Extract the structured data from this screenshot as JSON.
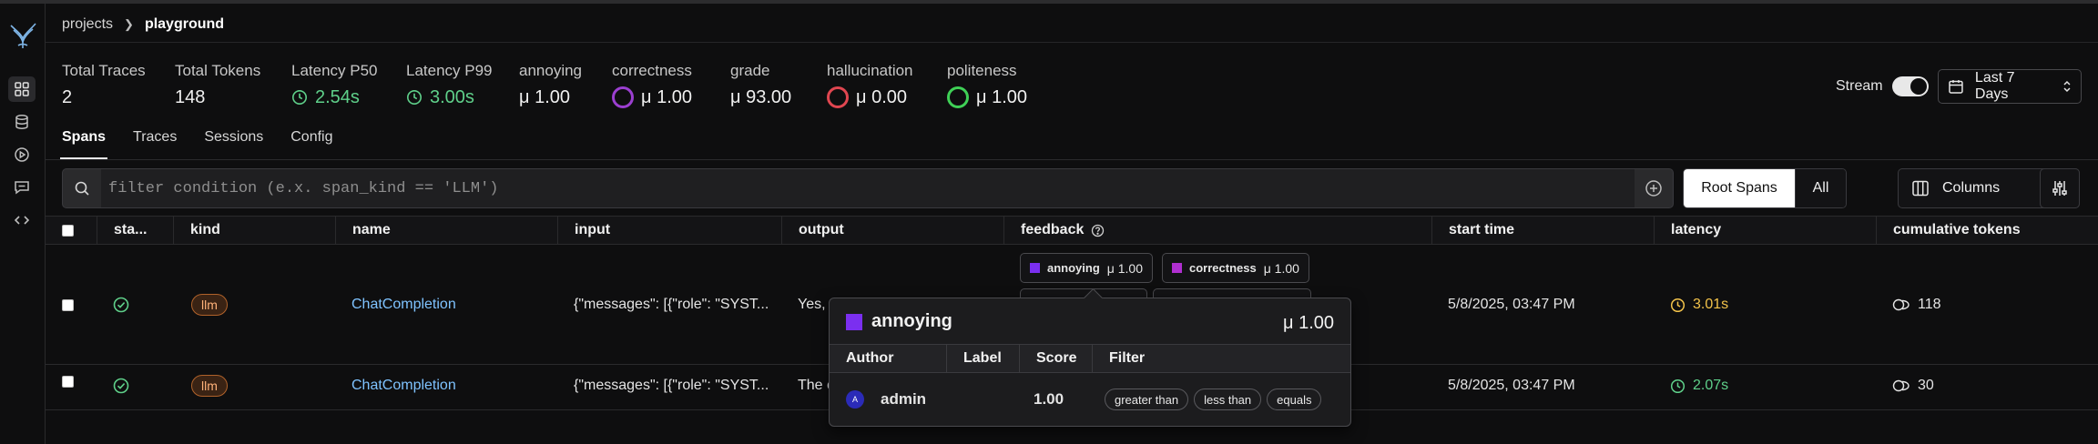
{
  "breadcrumb": {
    "items": [
      "projects"
    ],
    "current": "playground"
  },
  "stats": [
    {
      "label": "Total Traces",
      "value": "2"
    },
    {
      "label": "Total Tokens",
      "value": "148"
    },
    {
      "label": "Latency P50",
      "value": "2.54s",
      "icon": "clock-icon",
      "color": "#5fd08a"
    },
    {
      "label": "Latency P99",
      "value": "3.00s",
      "icon": "clock-icon",
      "color": "#5fd08a"
    },
    {
      "label": "annoying",
      "value": "μ 1.00"
    },
    {
      "label": "correctness",
      "value": "μ 1.00",
      "ring_color": "#9b3fd0"
    },
    {
      "label": "grade",
      "value": "μ 93.00"
    },
    {
      "label": "hallucination",
      "value": "μ 0.00",
      "ring_color": "#e04650"
    },
    {
      "label": "politeness",
      "value": "μ 1.00",
      "ring_color": "#3fd056"
    }
  ],
  "stream": {
    "label": "Stream",
    "enabled": true
  },
  "timerange": {
    "label": "Last 7 Days"
  },
  "tabs": [
    "Spans",
    "Traces",
    "Sessions",
    "Config"
  ],
  "active_tab": "Spans",
  "filter": {
    "placeholder": "filter condition (e.x. span_kind == 'LLM')",
    "value": ""
  },
  "span_toggle": {
    "root_label": "Root Spans",
    "all_label": "All",
    "selected": "Root Spans"
  },
  "columns_button": {
    "label": "Columns"
  },
  "table": {
    "headers": {
      "status": "sta...",
      "kind": "kind",
      "name": "name",
      "input": "input",
      "output": "output",
      "feedback": "feedback",
      "start_time": "start time",
      "latency": "latency",
      "cumulative_tokens": "cumulative tokens"
    },
    "rows": [
      {
        "kind": "llm",
        "name": "ChatCompletion",
        "input": "{\"messages\": [{\"role\": \"SYST...",
        "output": "Yes, c",
        "feedback": [
          {
            "name": "annoying",
            "score": "μ 1.00",
            "color": "#7b2ff0"
          },
          {
            "name": "correctness",
            "score": "μ 1.00",
            "color": "#b02fd0"
          }
        ],
        "start_time": "5/8/2025, 03:47 PM",
        "latency": "3.01s",
        "latency_color": "#f2c24a",
        "tokens": "118"
      },
      {
        "kind": "llm",
        "name": "ChatCompletion",
        "input": "{\"messages\": [{\"role\": \"SYST...",
        "output": "The c",
        "start_time": "5/8/2025, 03:47 PM",
        "latency": "2.07s",
        "latency_color": "#5fd08a",
        "tokens": "30"
      }
    ]
  },
  "popover": {
    "title": "annoying",
    "score": "μ 1.00",
    "color": "#7b2ff0",
    "headers": {
      "author": "Author",
      "label": "Label",
      "score": "Score",
      "filter": "Filter"
    },
    "row": {
      "avatar": "A",
      "author": "admin",
      "label": "",
      "score": "1.00",
      "filters": [
        "greater than",
        "less than",
        "equals"
      ]
    }
  }
}
